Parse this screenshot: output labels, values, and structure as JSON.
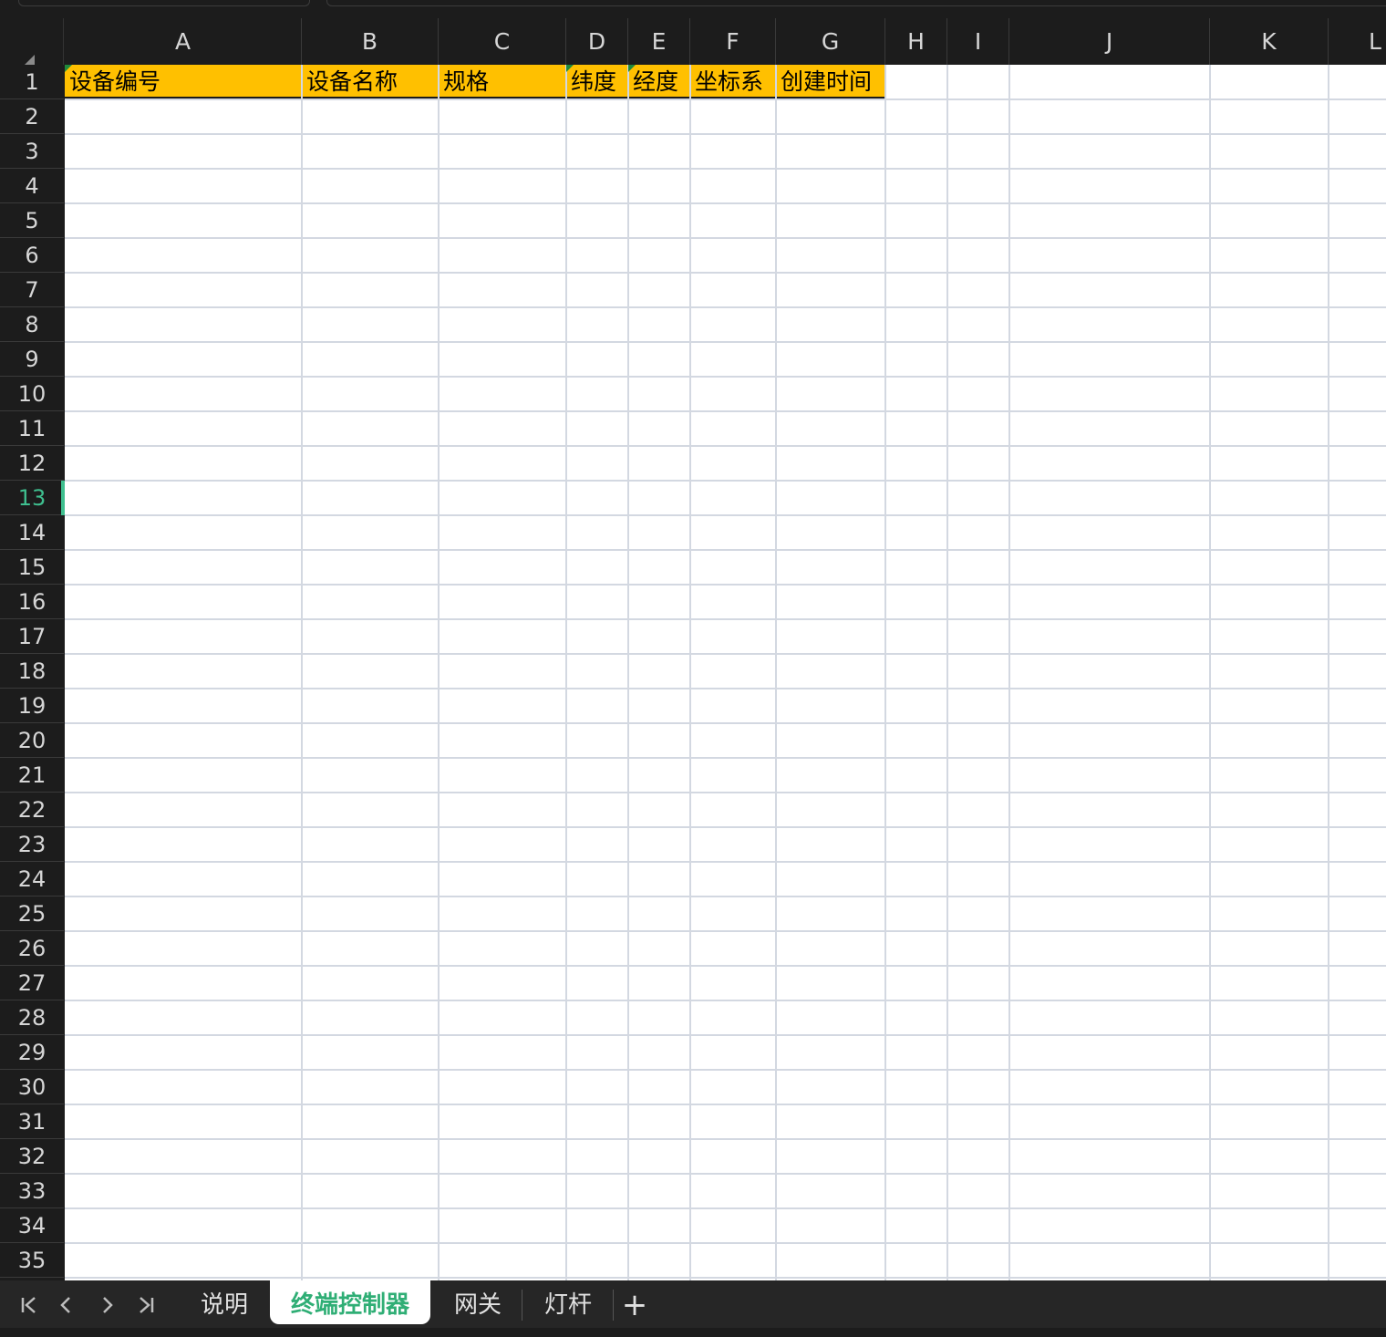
{
  "columns": [
    "A",
    "B",
    "C",
    "D",
    "E",
    "F",
    "G",
    "H",
    "I",
    "J",
    "K",
    "L"
  ],
  "rows": [
    "1",
    "2",
    "3",
    "4",
    "5",
    "6",
    "7",
    "8",
    "9",
    "10",
    "11",
    "12",
    "13",
    "14",
    "15",
    "16",
    "17",
    "18",
    "19",
    "20",
    "21",
    "22",
    "23",
    "24",
    "25",
    "26",
    "27",
    "28",
    "29",
    "30",
    "31",
    "32",
    "33",
    "34",
    "35"
  ],
  "active_row": "13",
  "header_cells": [
    {
      "col": "A",
      "text": "设备编号"
    },
    {
      "col": "B",
      "text": "设备名称"
    },
    {
      "col": "C",
      "text": "规格"
    },
    {
      "col": "D",
      "text": "纬度"
    },
    {
      "col": "E",
      "text": "经度"
    },
    {
      "col": "F",
      "text": "坐标系"
    },
    {
      "col": "G",
      "text": "创建时间"
    }
  ],
  "header_fill_color": "#ffc000",
  "accent_color": "#3fbf8f",
  "nav": {
    "first_icon": "K",
    "prev_icon": "‹",
    "next_icon": "›",
    "last_icon": "›|"
  },
  "sheets": [
    {
      "label": "说明",
      "active": false
    },
    {
      "label": "终端控制器",
      "active": true
    },
    {
      "label": "网关",
      "active": false
    },
    {
      "label": "灯杆",
      "active": false
    }
  ],
  "add_sheet_label": "+"
}
